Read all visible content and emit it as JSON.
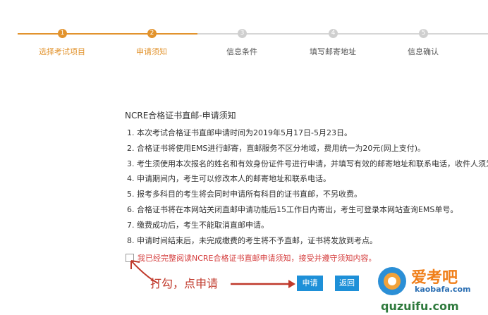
{
  "stepper": {
    "steps": [
      {
        "num": "1",
        "label": "选择考试项目"
      },
      {
        "num": "2",
        "label": "申请须知"
      },
      {
        "num": "3",
        "label": "信息条件"
      },
      {
        "num": "4",
        "label": "填写邮寄地址"
      },
      {
        "num": "5",
        "label": "信息确认"
      }
    ],
    "active_color": "#e2932d",
    "inactive_color": "#cfcfcf"
  },
  "notice": {
    "title": "NCRE合格证书直邮-申请须知",
    "items": [
      "1.  本次考试合格证书直邮申请时间为2019年5月17日-5月23日。",
      "2.  合格证书将使用EMS进行邮寄，直邮服务不区分地域，费用统一为20元(网上支付)。",
      "3.  考生须使用本次报名的姓名和有效身份证件号进行申请，并填写有效的邮寄地址和联系电话，收件人须为",
      "4.  申请期间内，考生可以修改本人的邮寄地址和联系电话。",
      "5.  报考多科目的考生将会同时申请所有科目的证书直邮，不另收费。",
      "6.  合格证书将在本网站关闭直邮申请功能后15工作日内寄出，考生可登录本网站查询EMS单号。",
      "7.  缴费成功后，考生不能取消直邮申请。",
      "8.  申请时间结束后，未完成缴费的考生将不予直邮，证书将发放到考点。"
    ]
  },
  "agree": {
    "text": "我已经完整阅读NCRE合格证书直邮申请须知，接受并遵守须知内容。",
    "checked": false
  },
  "buttons": {
    "apply": "申请",
    "back": "返回"
  },
  "annotation": "打勾，点申请",
  "watermark": {
    "brand": "爱考吧",
    "url": "kaobafa.com",
    "line2": "quzuifu.com"
  }
}
